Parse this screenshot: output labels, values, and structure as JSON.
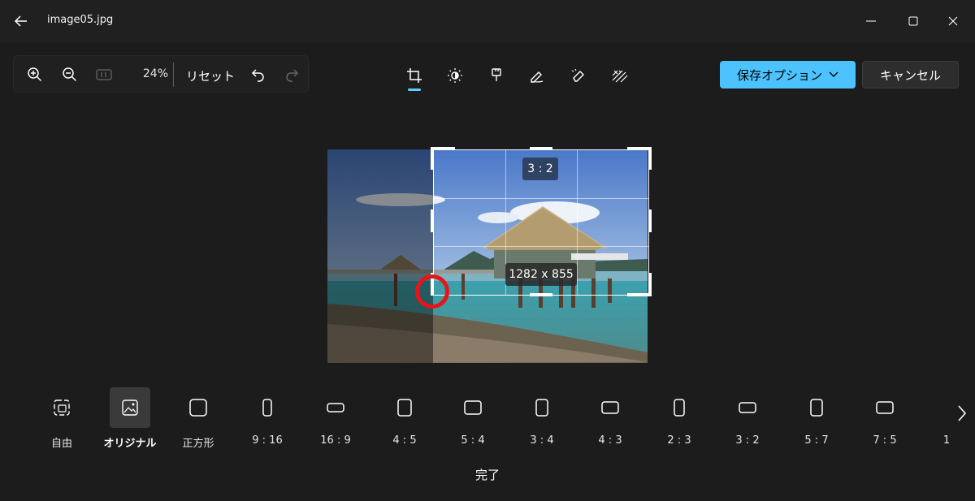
{
  "window": {
    "title": "image05.jpg"
  },
  "toolbar": {
    "zoom_level": "24%",
    "reset_label": "リセット",
    "save_label": "保存オプション",
    "cancel_label": "キャンセル"
  },
  "crop": {
    "ratio_label": "3 : 2",
    "size_label": "1282 x 855"
  },
  "aspect_ratios": [
    {
      "label": "自由"
    },
    {
      "label": "オリジナル"
    },
    {
      "label": "正方形"
    },
    {
      "label": "9 : 16"
    },
    {
      "label": "16 : 9"
    },
    {
      "label": "4 : 5"
    },
    {
      "label": "5 : 4"
    },
    {
      "label": "3 : 4"
    },
    {
      "label": "4 : 3"
    },
    {
      "label": "2 : 3"
    },
    {
      "label": "3 : 2"
    },
    {
      "label": "5 : 7"
    },
    {
      "label": "7 : 5"
    },
    {
      "label": "1"
    }
  ],
  "footer": {
    "done_label": "完了"
  },
  "colors": {
    "accent": "#4cc2ff",
    "underline": "#60cdff",
    "annotation": "#e8141a",
    "background": "#1c1c1c"
  }
}
